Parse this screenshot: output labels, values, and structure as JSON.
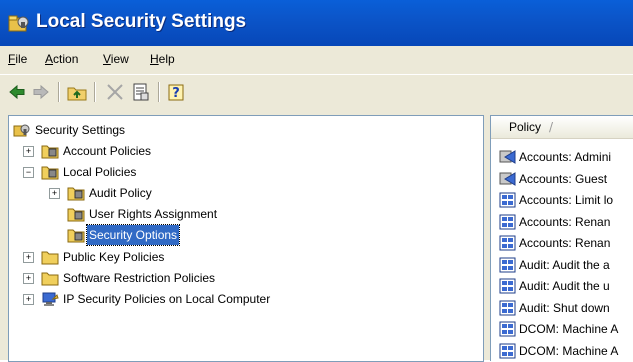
{
  "window": {
    "title": "Local Security Settings"
  },
  "menu": [
    {
      "mn": "F",
      "rest": "ile"
    },
    {
      "mn": "A",
      "rest": "ction"
    },
    {
      "mn": "V",
      "rest": "iew"
    },
    {
      "mn": "H",
      "rest": "elp"
    }
  ],
  "toolbar": [
    "back-arrow-icon",
    "forward-arrow-icon",
    "up-folder-icon",
    "delete-icon",
    "properties-icon",
    "help-icon"
  ],
  "tree": {
    "root": "Security Settings",
    "account_policies": "Account Policies",
    "local_policies": "Local Policies",
    "audit_policy": "Audit Policy",
    "user_rights": "User Rights Assignment",
    "security_options": "Security Options",
    "public_key": "Public Key Policies",
    "software_restriction": "Software Restriction Policies",
    "ip_security": "IP Security Policies on Local Computer",
    "expander_plus": "+",
    "expander_minus": "−"
  },
  "list": {
    "header": "Policy",
    "sort_glyph": "/",
    "rows": [
      "Accounts: Admini",
      "Accounts: Guest",
      "Accounts: Limit lo",
      "Accounts: Renan",
      "Accounts: Renan",
      "Audit: Audit the a",
      "Audit: Audit the u",
      "Audit: Shut down",
      "DCOM: Machine A",
      "DCOM: Machine A"
    ]
  }
}
